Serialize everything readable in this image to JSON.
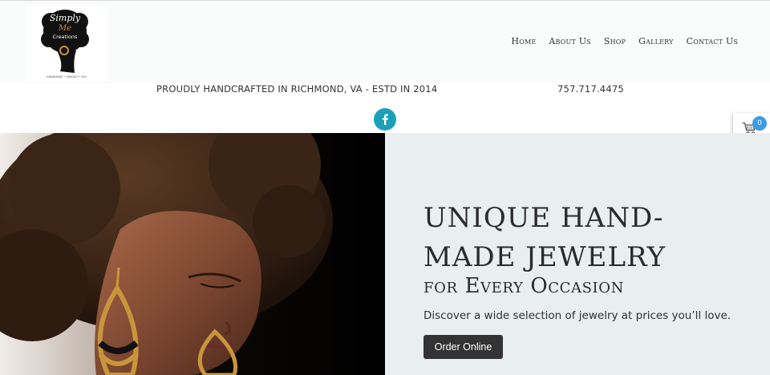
{
  "brand": {
    "logo_script_line1": "Simply",
    "logo_script_line2": "Me",
    "logo_script_line3": "Creations",
    "logo_tagline": "HANDMADE • UNIQUE • YOU"
  },
  "nav": {
    "items": [
      "Home",
      "About Us",
      "Shop",
      "Gallery",
      "Contact Us"
    ]
  },
  "topbar": {
    "tagline": "PROUDLY HANDCRAFTED IN RICHMOND, VA - ESTD  IN 2014",
    "phone": "757.717.4475"
  },
  "cart": {
    "count": "0"
  },
  "hero": {
    "heading_line1": "UNIQUE HAND-",
    "heading_line2": "MADE JEWELRY",
    "heading_line3": "for Every Occasion",
    "subtext": "Discover a wide selection of jewelry at prices you’ll love.",
    "cta_label": "Order Online"
  },
  "colors": {
    "facebook": "#1aa0ba",
    "cart_badge": "#3b9be5",
    "panel_bg": "#e9eeee",
    "button_bg": "#333333",
    "earring_gold": "#c9953c"
  },
  "icons": {
    "social": "facebook-icon",
    "cart": "shopping-cart-icon"
  }
}
